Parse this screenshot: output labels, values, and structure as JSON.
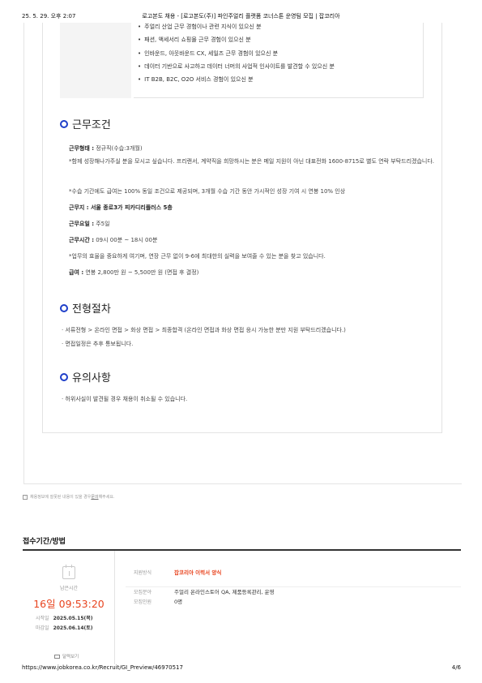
{
  "print_header": {
    "datetime": "25. 5. 29. 오후 2:07",
    "title": "로고본도 채용 - [로고본도(주)] 파인주얼리 플랫폼 코너스톤 운영팀 모집 | 잡코리아"
  },
  "print_footer": {
    "url": "https://www.jobkorea.co.kr/Recruit/GI_Preview/46970517",
    "page": "4/6"
  },
  "qualifications": [
    "주얼리 산업 근무 경험이나 관련 지식이 있으신 분",
    "패션, 액세서리 쇼핑몰 근무 경험이 있으신 분",
    "인바운드, 아웃바운드 CX, 세일즈 근무 경험이 있으신 분",
    "데이터 기반으로 사고하고 데이터 너머의 사업적 인사이트를 발견할 수 있으신 분",
    "IT B2B, B2C, O2O 서비스 경험이 있으신 분"
  ],
  "conditions": {
    "title": "근무조건",
    "employment_label": "근무형태 :",
    "employment_value": " 정규직(수습:3개월)",
    "note1": "*함께 성장해나가주실 분을 모시고 싶습니다. 프리랜서, 계약직을 희망하시는 분은 메일 지원이 아닌 대표전화 1600-8715로 별도 연락 부탁드리겠습니다.",
    "note2": "*수습 기간에도 급여는 100% 동일 조건으로 제공되며, 3개월 수습 기간 동안 가시적인 성장 기여 시 연봉 10% 인상",
    "location": "근무지 : 서울 종로3가 피카디리플러스 5층",
    "days_label": "근무요일 :",
    "days_value": " 주5일",
    "hours_label": "근무시간 :",
    "hours_value": " 09시 00분 ~ 18시 00분",
    "note3": "*업무의 효율을 중요하게 여기며, 연장 근무 없이 9-6에 최대한의 실력을 보여줄 수 있는 분을 찾고 있습니다.",
    "salary_label": "급여 :",
    "salary_value": " 연봉 2,800만 원 ~ 5,500만 원 (면접 후 결정)"
  },
  "process": {
    "title": "전형절차",
    "items": [
      "· 서류전형 > 온라인 면접 > 화상 면접 > 최종합격 (온라인 면접과 화상 면접 응시 가능한 분만 지원 부탁드리겠습니다.)",
      "· 면접일정은 추후 통보됩니다."
    ]
  },
  "cautions": {
    "title": "유의사항",
    "items": [
      "· 허위사실이 발견될 경우 채용이 취소될 수 있습니다."
    ]
  },
  "notice": {
    "text_before": "채용정보에 잘못된 내용이 있을 경우 ",
    "link": "문의",
    "text_after": "해주세요."
  },
  "apply": {
    "title": "접수기간/방법",
    "remain_label": "남은시간",
    "countdown": "16일 09:53:20",
    "start_label": "시작일",
    "start_value": "2025.05.15(목)",
    "end_label": "마감일",
    "end_value": "2025.06.14(토)",
    "calendar_link": "달력보기",
    "method_label": "지원방식",
    "method_value": "잡코리아 이력서 양식",
    "field_label": "모집분야",
    "field_value": "주얼리 온라인스토어 QA, 제품등록관리, 운영",
    "count_label": "모집인원",
    "count_value": "0명"
  },
  "colors": {
    "accent_blue": "#1f3fc9",
    "accent_red": "#e8441f"
  }
}
